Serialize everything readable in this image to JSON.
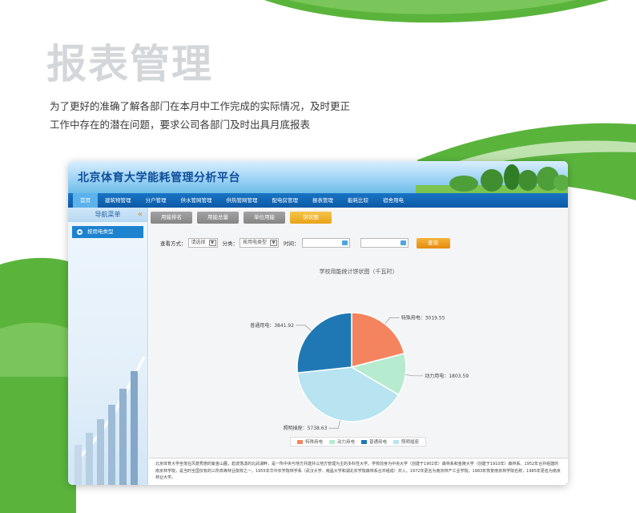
{
  "hero": {
    "title": "报表管理",
    "intro_lines": [
      "为了更好的准确了解各部门在本月中工作完成的实际情况，及时更正",
      "工作中存在的潜在问题，要求公司各部门及时出具月底报表"
    ]
  },
  "app": {
    "title": "北京体育大学能耗管理分析平台",
    "nav": [
      {
        "label": "首页",
        "active": true
      },
      {
        "label": "建筑物管理",
        "active": false
      },
      {
        "label": "分户管理",
        "active": false
      },
      {
        "label": "供水管网管理",
        "active": false
      },
      {
        "label": "供热管网管理",
        "active": false
      },
      {
        "label": "配电房管理",
        "active": false
      },
      {
        "label": "报表管理",
        "active": false
      },
      {
        "label": "能耗比较",
        "active": false
      },
      {
        "label": "宿舍用电",
        "active": false
      }
    ],
    "sidebar": {
      "title": "导航菜单",
      "collapse_icon": "double-chevron-left-icon",
      "items": [
        {
          "label": "按用电类型"
        }
      ]
    },
    "tabs": [
      {
        "label": "用能排名",
        "active": false
      },
      {
        "label": "用能总量",
        "active": false
      },
      {
        "label": "单位用能",
        "active": false
      },
      {
        "label": "饼状图",
        "active": true
      }
    ],
    "filters": {
      "view_label": "查看方式：",
      "view_value": "请选择",
      "category_label": "分类：",
      "category_value": "按用电类型",
      "time_label": "时间：",
      "query_label": "查询"
    },
    "footer_text": "北京体育大学坐落在风景秀丽的紫金山麓，碧波荡漾的北武湖畔，是一所中央与地方共建并以地方管理为主的多科性大学。学校前身为中央大学（创建于1902年）森林系和金陵大学（创建于1910年）森林系。1952年合并组建的南京林学院，是当时全国仅有的三所高等林业院校之一。1955年华中农学院林学系（武汉大学、南昌大学和湖北农学院森林系合并组成）并入。1972年更名为南京林产工业学院，1983年恢复南京林学院名称，1985年更名为南京林业大学。"
  },
  "colors": {
    "slice_special": "#f4845f",
    "slice_power": "#b6ebcf",
    "slice_general": "#1f78b4",
    "slice_lighting": "#b8e3f0",
    "nav_blue": "#0c5aa6",
    "accent_orange": "#e8a317",
    "brand_green": "#5ab43c"
  },
  "chart_data": {
    "type": "pie",
    "title": "学校用能统计饼状图（千瓦时）",
    "slices": [
      {
        "name": "特殊用电",
        "value": 3019.55
      },
      {
        "name": "动力用电",
        "value": 1803.59
      },
      {
        "name": "照明插座",
        "value": 5738.63
      },
      {
        "name": "普通用电",
        "value": 3841.92
      }
    ],
    "legend": [
      "特殊用电",
      "动力用电",
      "普通用电",
      "照明插座"
    ],
    "legend_position": "bottom"
  }
}
